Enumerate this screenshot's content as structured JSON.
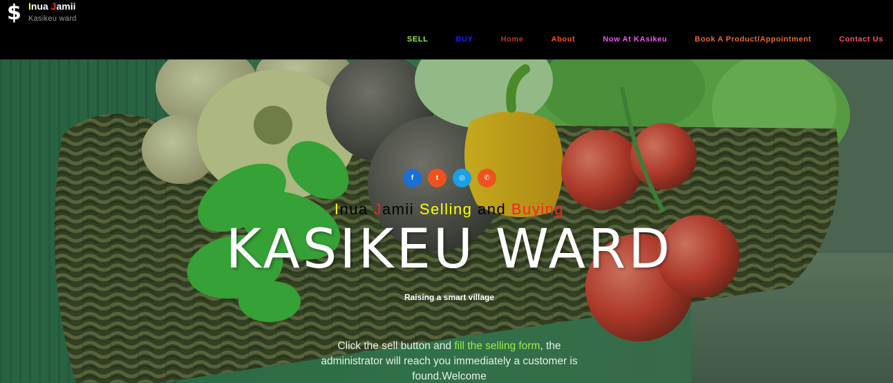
{
  "brand": {
    "icon": "$",
    "title_parts": [
      {
        "text": "I",
        "color": "#ffff00"
      },
      {
        "text": "nua ",
        "color": "#ffffff"
      },
      {
        "text": "J",
        "color": "#ff2a2a"
      },
      {
        "text": "amii",
        "color": "#ffffff"
      }
    ],
    "subtitle": "Kasikeu ward"
  },
  "nav": [
    {
      "label": "SELL",
      "color": "#9aee4a"
    },
    {
      "label": "BUY",
      "color": "#1b1bff"
    },
    {
      "label": "Home",
      "color": "#b03a2e"
    },
    {
      "label": "About",
      "color": "#ff4a1a"
    },
    {
      "label": "Now At KAsikeu",
      "color": "#ee55ee"
    },
    {
      "label": "Book A Product/Appointment",
      "color": "#ee6a2a"
    },
    {
      "label": "Contact Us",
      "color": "#ff4d6e"
    }
  ],
  "social": [
    {
      "icon": "facebook-icon",
      "glyph": "f",
      "color": "#1a6fd6"
    },
    {
      "icon": "twitter-icon",
      "glyph": "t",
      "color": "#f0521e"
    },
    {
      "icon": "instagram-icon",
      "glyph": "◎",
      "color": "#1aa0e8"
    },
    {
      "icon": "whatsapp-icon",
      "glyph": "✆",
      "color": "#f0521e"
    }
  ],
  "hero": {
    "tagline_parts": [
      {
        "text": "I",
        "color": "#ffff00"
      },
      {
        "text": "nua ",
        "color": "#000000"
      },
      {
        "text": "J",
        "color": "#ff2020"
      },
      {
        "text": "amii ",
        "color": "#000000"
      },
      {
        "text": "Selling",
        "color": "#ffff00"
      },
      {
        "text": " and ",
        "color": "#000000"
      },
      {
        "text": "Buying",
        "color": "#ff2020"
      }
    ],
    "title": "KASIKEU WARD",
    "subtitle": "Raising a smart village",
    "info_parts": [
      {
        "text": "Click the sell button and ",
        "color": "#e6f0e6"
      },
      {
        "text": "fill the selling form",
        "color": "#9aee4a"
      },
      {
        "text": ", the administrator will reach you immediately a customer is found.Welcome",
        "color": "#e6f0e6"
      }
    ]
  }
}
